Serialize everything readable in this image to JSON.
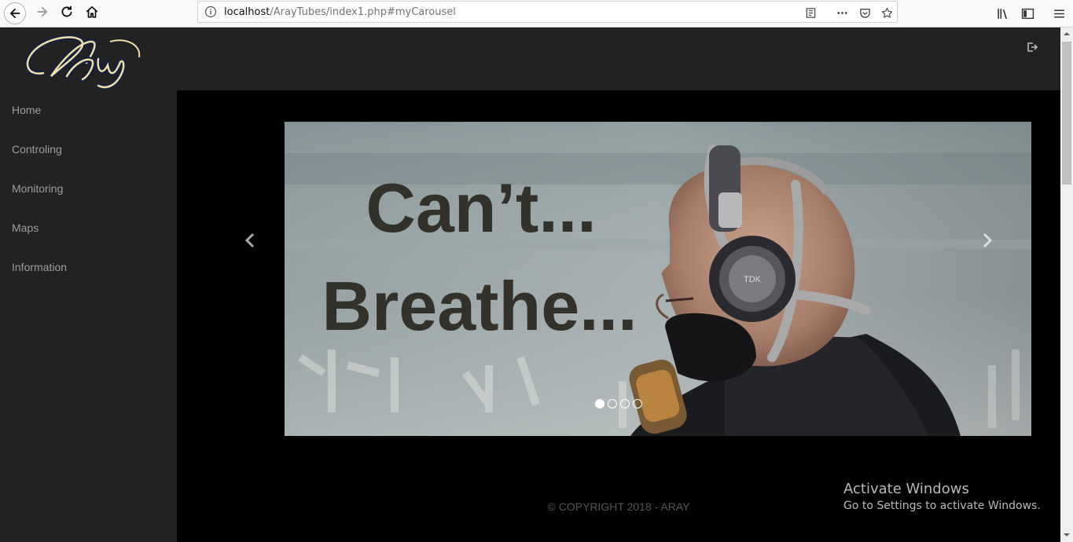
{
  "browser": {
    "url_host": "localhost",
    "url_path": "/ArayTubes/index1.php#myCarousel"
  },
  "sidebar": {
    "logo_text": "Aray",
    "items": [
      {
        "label": "Home"
      },
      {
        "label": "Controling"
      },
      {
        "label": "Monitoring"
      },
      {
        "label": "Maps"
      },
      {
        "label": "Information"
      }
    ]
  },
  "carousel": {
    "slide_line1": "Can’t...",
    "slide_line2": "Breathe...",
    "headphone_brand": "TDK",
    "slide_count": 4,
    "active_index": 0
  },
  "footer": {
    "copyright": "© COPYRIGHT 2018 - ARAY"
  },
  "watermark": {
    "title": "Activate Windows",
    "subtitle": "Go to Settings to activate Windows."
  },
  "colors": {
    "sidebar_bg": "#222222",
    "content_bg": "#000000",
    "menu_text": "#9d9d9d",
    "logo_gold": "#f1dfa8"
  },
  "icons": [
    "back-icon",
    "forward-icon",
    "reload-icon",
    "home-icon",
    "info-icon",
    "reader-view-icon",
    "more-actions-icon",
    "pocket-icon",
    "bookmark-star-icon",
    "library-icon",
    "sidebar-toggle-icon",
    "hamburger-menu-icon",
    "sign-out-icon",
    "chevron-left-icon",
    "chevron-right-icon"
  ]
}
